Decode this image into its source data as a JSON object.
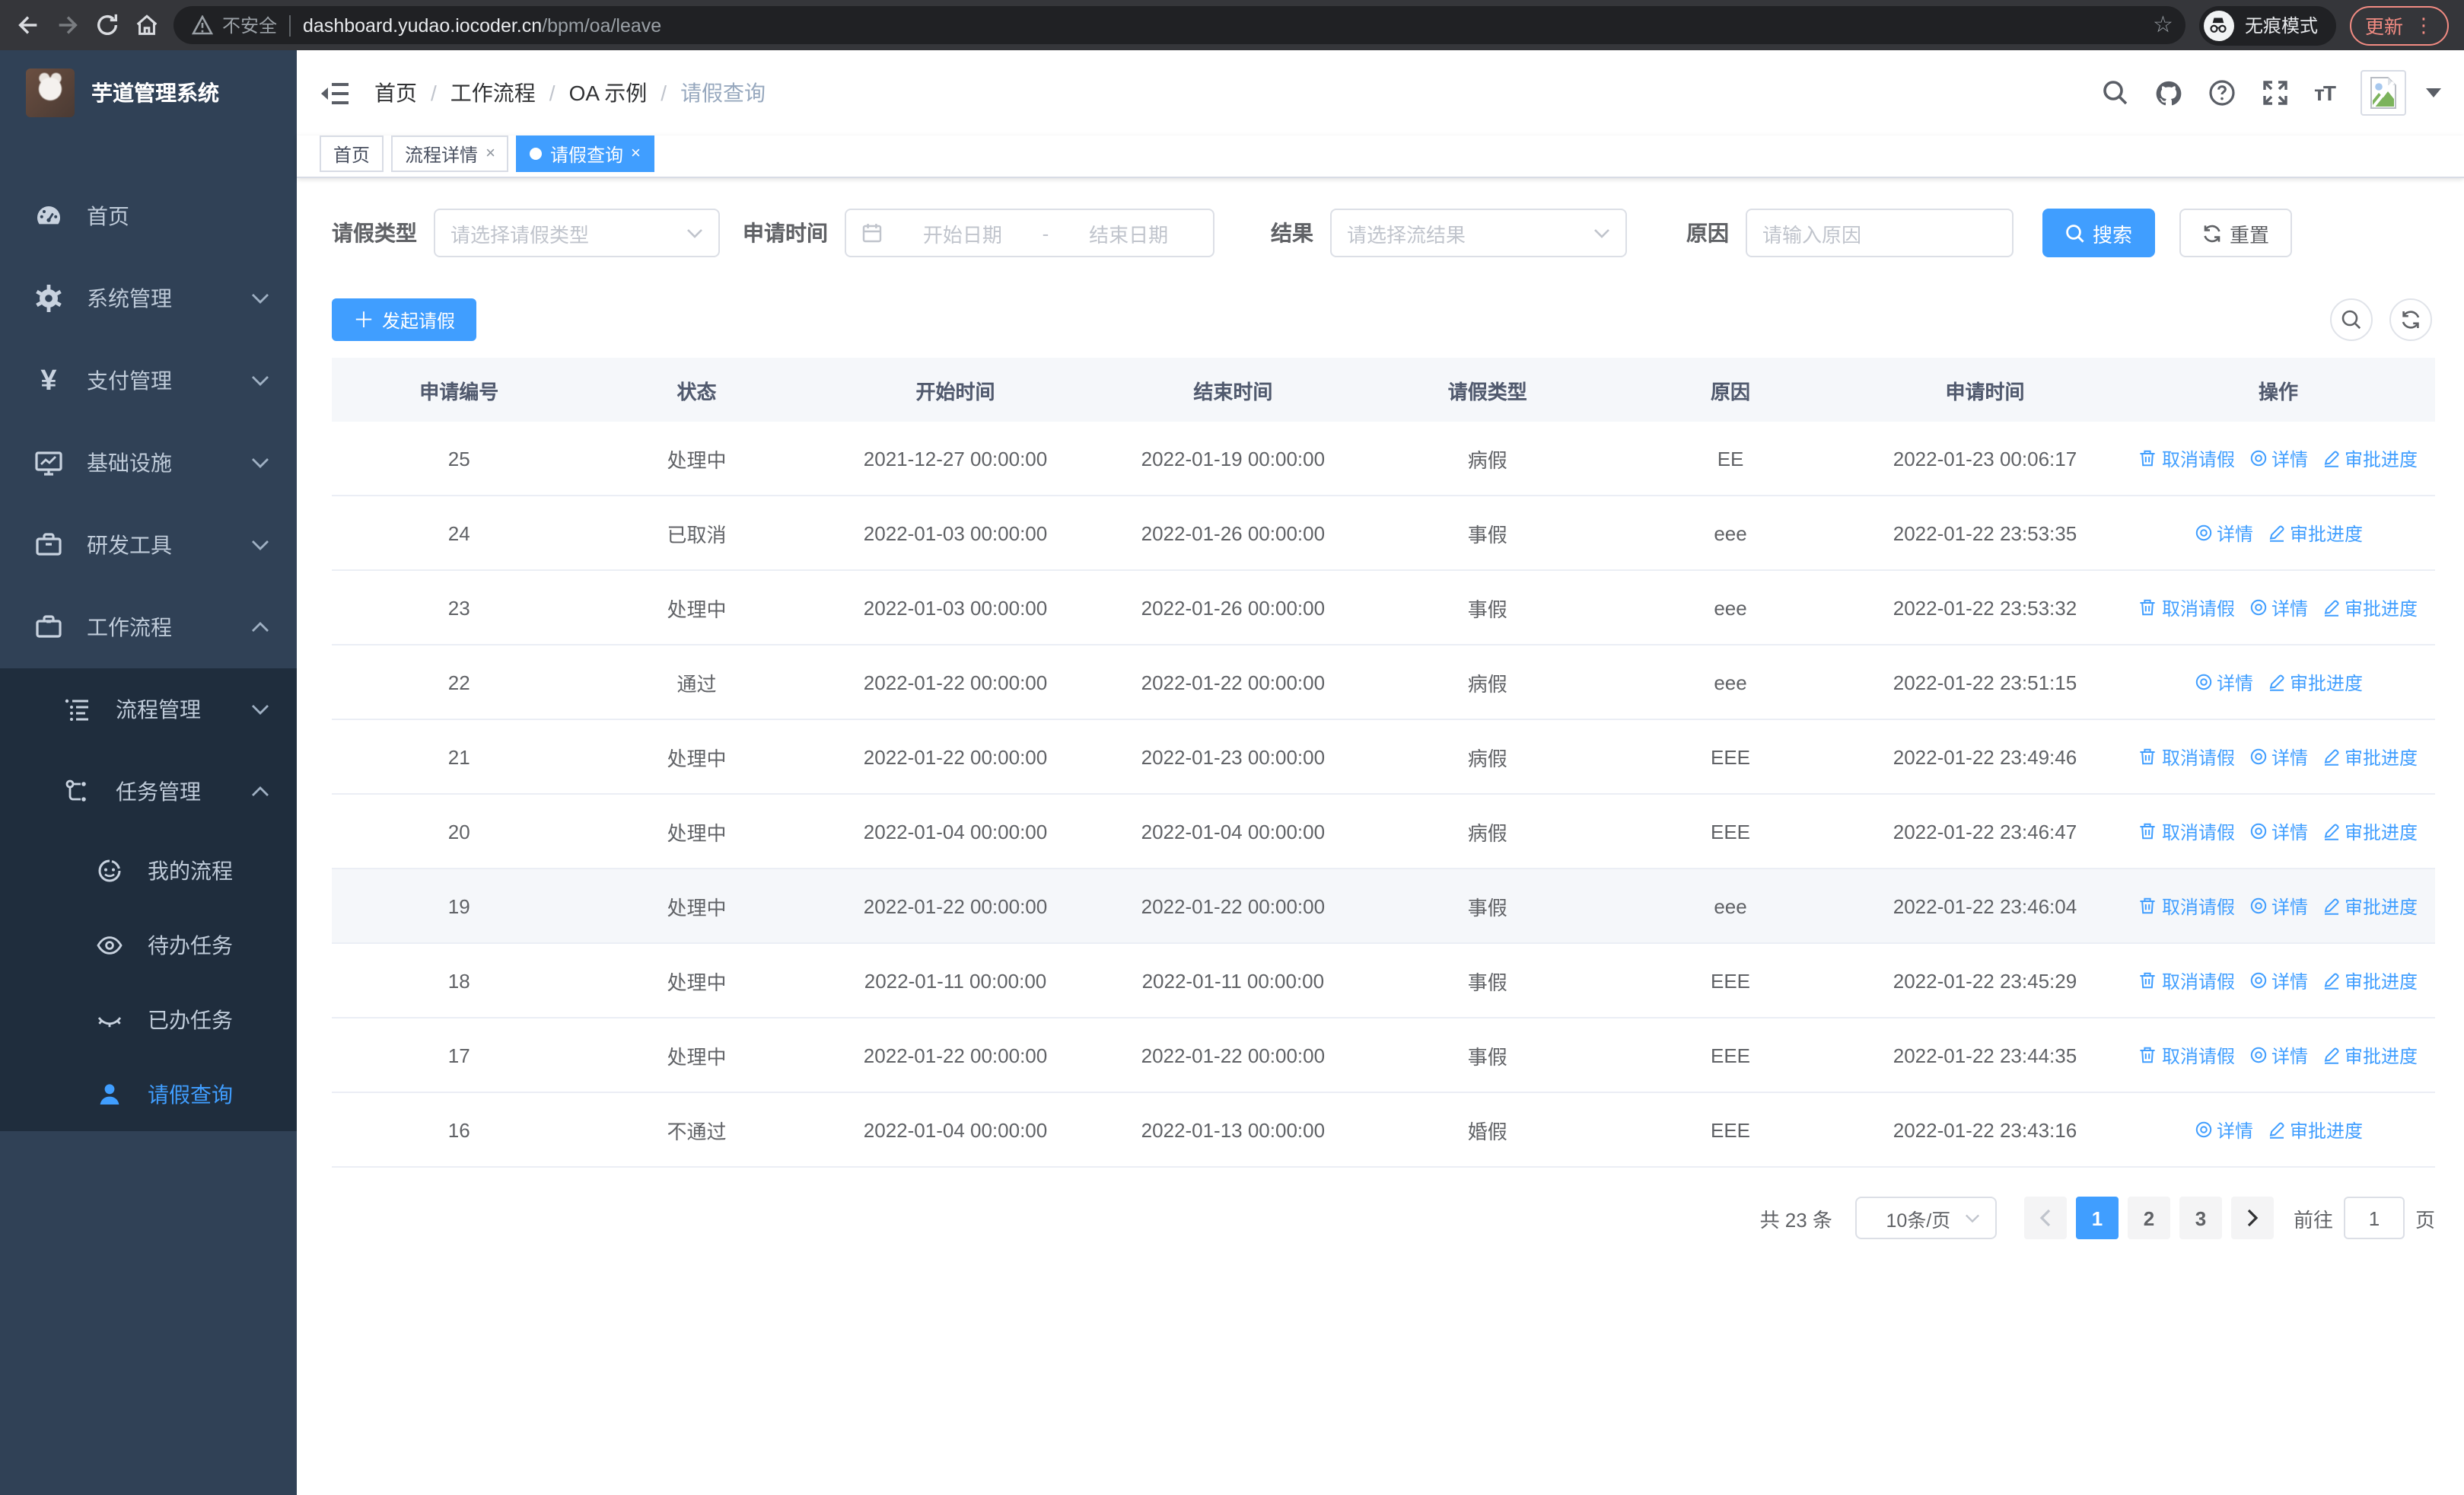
{
  "browser": {
    "security_label": "不安全",
    "url_host": "dashboard.yudao.iocoder.cn",
    "url_path": "/bpm/oa/leave",
    "incognito_label": "无痕模式",
    "update_label": "更新"
  },
  "sidebar": {
    "title": "芋道管理系统",
    "items": [
      {
        "label": "首页",
        "icon": "dashboard-icon"
      },
      {
        "label": "系统管理",
        "icon": "gear-icon"
      },
      {
        "label": "支付管理",
        "icon": "yen-icon"
      },
      {
        "label": "基础设施",
        "icon": "monitor-icon"
      },
      {
        "label": "研发工具",
        "icon": "toolbox-icon"
      },
      {
        "label": "工作流程",
        "icon": "briefcase-icon"
      }
    ],
    "submenu": [
      {
        "label": "流程管理",
        "icon": "list-icon"
      },
      {
        "label": "任务管理",
        "icon": "tree-icon"
      }
    ],
    "tasks": [
      {
        "label": "我的流程",
        "icon": "face-icon"
      },
      {
        "label": "待办任务",
        "icon": "eye-icon"
      },
      {
        "label": "已办任务",
        "icon": "eye-closed-icon"
      },
      {
        "label": "请假查询",
        "icon": "user-icon"
      }
    ]
  },
  "navbar": {
    "breadcrumb": [
      "首页",
      "工作流程",
      "OA 示例",
      "请假查询"
    ]
  },
  "tabs": [
    {
      "label": "首页"
    },
    {
      "label": "流程详情"
    },
    {
      "label": "请假查询"
    }
  ],
  "filters": {
    "leave_type_label": "请假类型",
    "leave_type_placeholder": "请选择请假类型",
    "apply_time_label": "申请时间",
    "start_date_placeholder": "开始日期",
    "range_separator": "-",
    "end_date_placeholder": "结束日期",
    "result_label": "结果",
    "result_placeholder": "请选择流结果",
    "reason_label": "原因",
    "reason_placeholder": "请输入原因",
    "search_label": "搜索",
    "reset_label": "重置"
  },
  "toolbar": {
    "create_label": "发起请假"
  },
  "table": {
    "columns": [
      "申请编号",
      "状态",
      "开始时间",
      "结束时间",
      "请假类型",
      "原因",
      "申请时间",
      "操作"
    ],
    "action_labels": {
      "cancel": "取消请假",
      "detail": "详情",
      "progress": "审批进度"
    },
    "rows": [
      {
        "id": "25",
        "status": "处理中",
        "start": "2021-12-27 00:00:00",
        "end": "2022-01-19 00:00:00",
        "type": "病假",
        "reason": "EE",
        "apply_time": "2022-01-23 00:06:17",
        "actions": [
          "cancel",
          "detail",
          "progress"
        ],
        "highlight": false
      },
      {
        "id": "24",
        "status": "已取消",
        "start": "2022-01-03 00:00:00",
        "end": "2022-01-26 00:00:00",
        "type": "事假",
        "reason": "eee",
        "apply_time": "2022-01-22 23:53:35",
        "actions": [
          "detail",
          "progress"
        ],
        "highlight": false
      },
      {
        "id": "23",
        "status": "处理中",
        "start": "2022-01-03 00:00:00",
        "end": "2022-01-26 00:00:00",
        "type": "事假",
        "reason": "eee",
        "apply_time": "2022-01-22 23:53:32",
        "actions": [
          "cancel",
          "detail",
          "progress"
        ],
        "highlight": false
      },
      {
        "id": "22",
        "status": "通过",
        "start": "2022-01-22 00:00:00",
        "end": "2022-01-22 00:00:00",
        "type": "病假",
        "reason": "eee",
        "apply_time": "2022-01-22 23:51:15",
        "actions": [
          "detail",
          "progress"
        ],
        "highlight": false
      },
      {
        "id": "21",
        "status": "处理中",
        "start": "2022-01-22 00:00:00",
        "end": "2022-01-23 00:00:00",
        "type": "病假",
        "reason": "EEE",
        "apply_time": "2022-01-22 23:49:46",
        "actions": [
          "cancel",
          "detail",
          "progress"
        ],
        "highlight": false
      },
      {
        "id": "20",
        "status": "处理中",
        "start": "2022-01-04 00:00:00",
        "end": "2022-01-04 00:00:00",
        "type": "病假",
        "reason": "EEE",
        "apply_time": "2022-01-22 23:46:47",
        "actions": [
          "cancel",
          "detail",
          "progress"
        ],
        "highlight": false
      },
      {
        "id": "19",
        "status": "处理中",
        "start": "2022-01-22 00:00:00",
        "end": "2022-01-22 00:00:00",
        "type": "事假",
        "reason": "eee",
        "apply_time": "2022-01-22 23:46:04",
        "actions": [
          "cancel",
          "detail",
          "progress"
        ],
        "highlight": true
      },
      {
        "id": "18",
        "status": "处理中",
        "start": "2022-01-11 00:00:00",
        "end": "2022-01-11 00:00:00",
        "type": "事假",
        "reason": "EEE",
        "apply_time": "2022-01-22 23:45:29",
        "actions": [
          "cancel",
          "detail",
          "progress"
        ],
        "highlight": false
      },
      {
        "id": "17",
        "status": "处理中",
        "start": "2022-01-22 00:00:00",
        "end": "2022-01-22 00:00:00",
        "type": "事假",
        "reason": "EEE",
        "apply_time": "2022-01-22 23:44:35",
        "actions": [
          "cancel",
          "detail",
          "progress"
        ],
        "highlight": false
      },
      {
        "id": "16",
        "status": "不通过",
        "start": "2022-01-04 00:00:00",
        "end": "2022-01-13 00:00:00",
        "type": "婚假",
        "reason": "EEE",
        "apply_time": "2022-01-22 23:43:16",
        "actions": [
          "detail",
          "progress"
        ],
        "highlight": false
      }
    ]
  },
  "pagination": {
    "total_label": "共 23 条",
    "page_size": "10条/页",
    "pages": [
      "1",
      "2",
      "3"
    ],
    "active_page": "1",
    "goto_label": "前往",
    "goto_value": "1",
    "page_unit": "页"
  },
  "colors": {
    "primary": "#409eff",
    "sidebar_bg": "#304156",
    "submenu_bg": "#1f2d3d",
    "update_accent": "#f28b82"
  }
}
